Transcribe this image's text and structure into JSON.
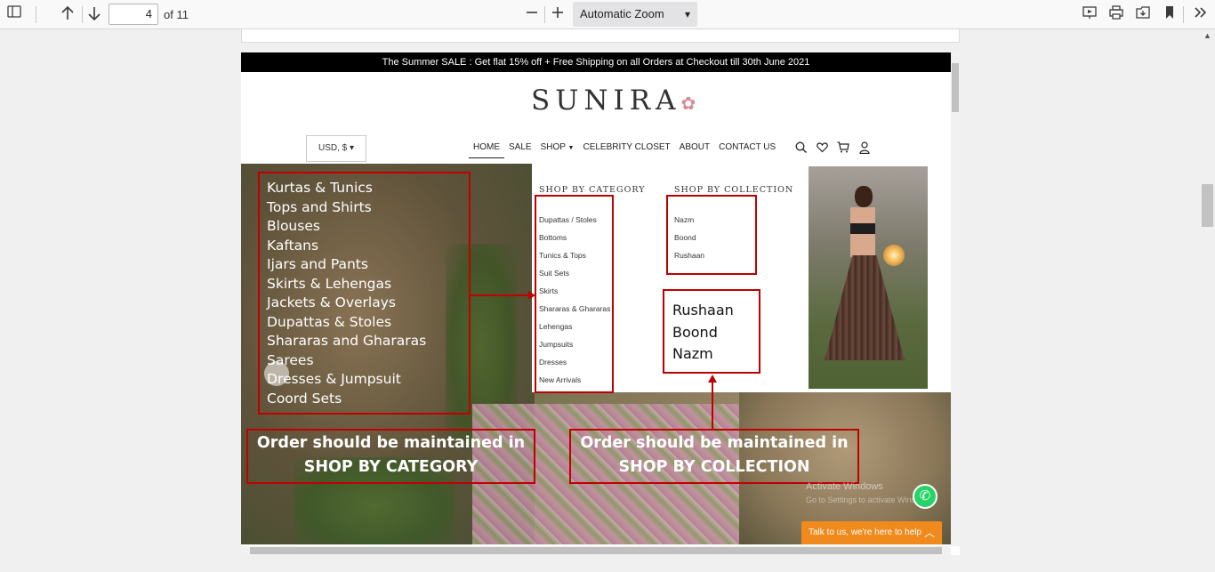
{
  "toolbar": {
    "page_number": "4",
    "page_of": "of 11",
    "zoom": "Automatic Zoom"
  },
  "site": {
    "announcement": "The Summer SALE : Get flat 15% off + Free Shipping on all Orders at Checkout till 30th June 2021",
    "logo": "SUNIRA",
    "currency": "USD, $",
    "nav": [
      "HOME",
      "SALE",
      "SHOP",
      "CELEBRITY CLOSET",
      "ABOUT",
      "CONTACT US"
    ]
  },
  "mega_menu": {
    "category_title": "SHOP BY CATEGORY",
    "categories": [
      "Dupattas / Stoles",
      "Bottoms",
      "Tunics & Tops",
      "Suit Sets",
      "Skirts",
      "Shararas & Ghararas",
      "Lehengas",
      "Jumpsuits",
      "Dresses",
      "New Arrivals"
    ],
    "collection_title": "SHOP BY COLLECTION",
    "collections": [
      "Nazm",
      "Boond",
      "Rushaan"
    ]
  },
  "annotations": {
    "category_order": [
      "Kurtas & Tunics",
      "Tops and Shirts",
      "Blouses",
      "Kaftans",
      "Ijars and Pants",
      "Skirts & Lehengas",
      "Jackets & Overlays",
      "Dupattas & Stoles",
      "Shararas and Ghararas",
      "Sarees",
      "Dresses & Jumpsuit",
      "Coord Sets"
    ],
    "collection_order": [
      "Rushaan",
      "Boond",
      "Nazm"
    ],
    "note_category_line1": "Order should be maintained in",
    "note_category_line2": "SHOP BY CATEGORY",
    "note_collection_line1": "Order should be maintained in",
    "note_collection_line2": "SHOP BY COLLECTION"
  },
  "overlays": {
    "watermark_title": "Activate Windows",
    "watermark_sub": "Go to Settings to activate Windows.",
    "chat_label": "Talk to us, we're here to help"
  },
  "colors": {
    "annotation_red": "#c00000",
    "chat_orange": "#f08a1c",
    "whatsapp_green": "#25d366"
  }
}
